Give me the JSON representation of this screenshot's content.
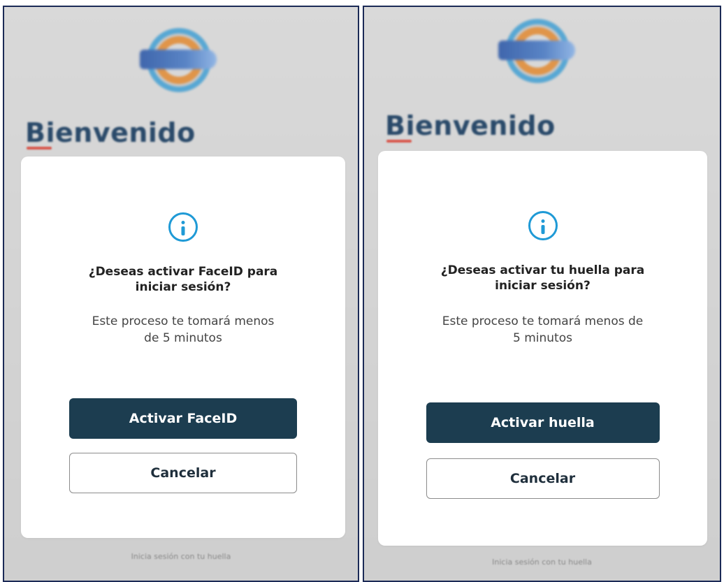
{
  "screens": [
    {
      "welcome_title": "Bienvenido",
      "modal": {
        "icon": "info-icon",
        "question": "¿Deseas activar FaceID para iniciar sesión?",
        "subtitle": "Este proceso te tomará menos de 5 minutos",
        "primary_button": "Activar FaceID",
        "secondary_button": "Cancelar"
      },
      "footer_text": "Inicia sesión con tu huella"
    },
    {
      "welcome_title": "Bienvenido",
      "modal": {
        "icon": "info-icon",
        "question": "¿Deseas activar tu huella para iniciar sesión?",
        "subtitle": "Este proceso te tomará menos de 5 minutos",
        "primary_button": "Activar huella",
        "secondary_button": "Cancelar"
      },
      "footer_text": "Inicia sesión con tu huella"
    }
  ],
  "colors": {
    "primary_button_bg": "#1c3d50",
    "info_icon": "#1f9ad6",
    "welcome_accent": "#d8554a",
    "frame_border": "#1b2a56"
  }
}
